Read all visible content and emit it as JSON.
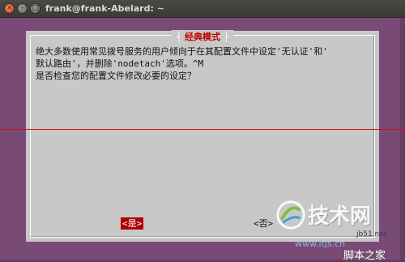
{
  "window": {
    "title": "frank@frank-Abelard: ~",
    "close_glyph": "×",
    "minimize_glyph": "–",
    "maximize_glyph": "□"
  },
  "dialog": {
    "title": "经典模式",
    "message": "绝大多数使用常见拨号服务的用户倾向于在其配置文件中设定'无认证'和'\n默认路由'，并删除'nodetach'选项。^M\n是否检查您的配置文件修改必要的设定？",
    "yes_label": "<是>",
    "no_label": "<否>"
  },
  "watermark": {
    "brand": "技术网",
    "url": "www.itjs.cn",
    "small": "jb51.net",
    "bottom": "脚本之家"
  },
  "colors": {
    "terminal_bg": "#7a4a77",
    "dialog_bg": "#c8c8c8",
    "accent_red": "#b00000"
  }
}
